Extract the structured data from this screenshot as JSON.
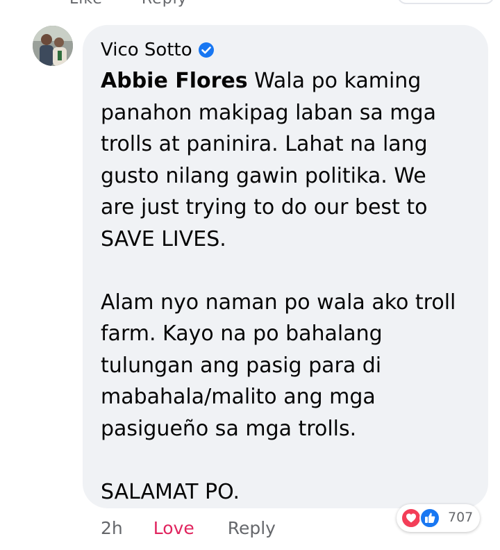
{
  "previous_comment": {
    "actions": [
      "Like",
      "Reply"
    ]
  },
  "comment": {
    "author": "Vico Sotto",
    "verified_icon": "verified-badge-icon",
    "mention": "Abbie Flores",
    "body": " Wala po kaming\npanahon makipag laban sa mga\ntrolls at paninira. Lahat na lang\ngusto nilang gawin politika. We\nare just trying to do our best to\nSAVE LIVES.\n\nAlam nyo naman po wala ako troll\nfarm. Kayo na po bahalang\ntulungan ang pasig para di\nmabahala/malito ang mga\npasigueño sa mga trolls.\n\nSALAMAT PO.",
    "time": "2h",
    "love_label": "Love",
    "reply_label": "Reply",
    "reactions": {
      "icons": [
        "heart-icon",
        "like-icon"
      ],
      "count": "707"
    }
  },
  "colors": {
    "bubble": "#f0f2f5",
    "love": "#e0245e",
    "like_blue": "#1877f2",
    "heart_red": "#f33e58",
    "meta_gray": "#65676b"
  }
}
